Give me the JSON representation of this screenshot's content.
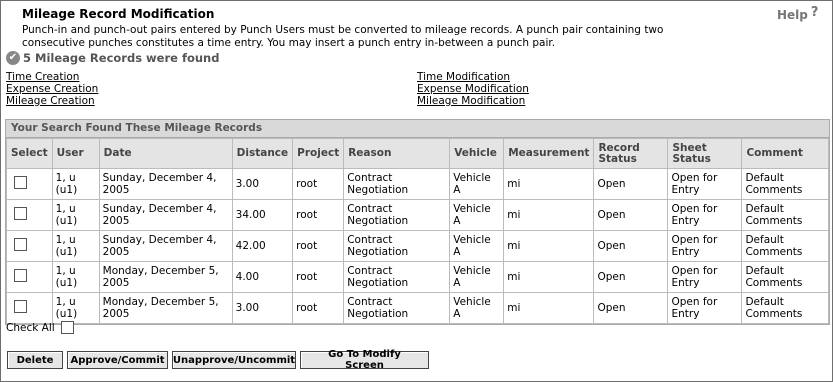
{
  "title": "Mileage Record Modification",
  "help": {
    "label": "Help",
    "icon": "question-icon"
  },
  "description": "Punch-in and punch-out pairs entered by Punch Users must be converted to mileage records. A punch pair containing two consecutive punches constitutes a time entry. You may insert a punch entry in-between a punch pair.",
  "found_message": "5 Mileage Records were found",
  "links_left": [
    "Time Creation",
    "Expense Creation",
    "Mileage Creation"
  ],
  "links_right": [
    "Time Modification",
    "Expense Modification",
    "Mileage Modification"
  ],
  "results_header": "Your Search Found These Mileage Records",
  "columns": [
    "Select",
    "User",
    "Date",
    "Distance",
    "Project",
    "Reason",
    "Vehicle",
    "Measurement",
    "Record Status",
    "Sheet Status",
    "Comment"
  ],
  "rows": [
    {
      "user": "1, u (u1)",
      "date": "Sunday, December 4, 2005",
      "distance": "3.00",
      "project": "root",
      "reason": "Contract Negotiation",
      "vehicle": "Vehicle A",
      "measurement": "mi",
      "record_status": "Open",
      "sheet_status": "Open for Entry",
      "comment": "Default Comments"
    },
    {
      "user": "1, u (u1)",
      "date": "Sunday, December 4, 2005",
      "distance": "34.00",
      "project": "root",
      "reason": "Contract Negotiation",
      "vehicle": "Vehicle A",
      "measurement": "mi",
      "record_status": "Open",
      "sheet_status": "Open for Entry",
      "comment": "Default Comments"
    },
    {
      "user": "1, u (u1)",
      "date": "Sunday, December 4, 2005",
      "distance": "42.00",
      "project": "root",
      "reason": "Contract Negotiation",
      "vehicle": "Vehicle A",
      "measurement": "mi",
      "record_status": "Open",
      "sheet_status": "Open for Entry",
      "comment": "Default Comments"
    },
    {
      "user": "1, u (u1)",
      "date": "Monday, December 5, 2005",
      "distance": "4.00",
      "project": "root",
      "reason": "Contract Negotiation",
      "vehicle": "Vehicle A",
      "measurement": "mi",
      "record_status": "Open",
      "sheet_status": "Open for Entry",
      "comment": "Default Comments"
    },
    {
      "user": "1, u (u1)",
      "date": "Monday, December 5, 2005",
      "distance": "3.00",
      "project": "root",
      "reason": "Contract Negotiation",
      "vehicle": "Vehicle A",
      "measurement": "mi",
      "record_status": "Open",
      "sheet_status": "Open for Entry",
      "comment": "Default Comments"
    }
  ],
  "check_all_label": "Check All",
  "buttons": {
    "delete": "Delete",
    "approve": "Approve/Commit",
    "unapprove": "Unapprove/Uncommit",
    "modify": "Go To Modify Screen"
  }
}
